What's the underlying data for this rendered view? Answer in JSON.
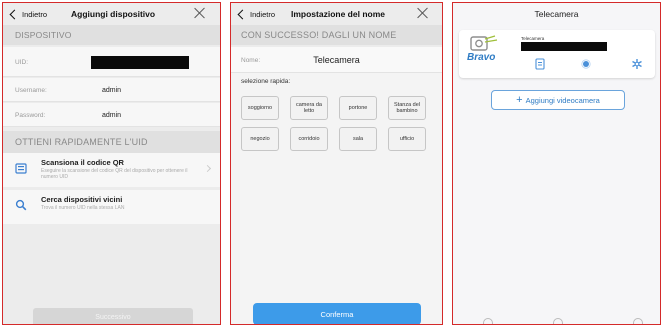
{
  "screen1": {
    "back_label": "Indietro",
    "title": "Aggiungi dispositivo",
    "section_device": "DISPOSITIVO",
    "uid_label": "UID:",
    "username_label": "Username:",
    "username_value": "admin",
    "password_label": "Password:",
    "password_value": "admin",
    "section_uid": "OTTIENI RAPIDAMENTE L'UID",
    "qr_title": "Scansiona il codice QR",
    "qr_desc": "Eseguire la scansione del codice QR del dispositivo per ottenere il numero UID",
    "search_title": "Cerca dispositivi vicini",
    "search_desc": "Trova il numero UID nella stessa LAN",
    "next_button": "Successivo"
  },
  "screen2": {
    "back_label": "Indietro",
    "title": "Impostazione del nome",
    "success_banner": "CON SUCCESSO! DAGLI UN NOME",
    "name_label": "Nome:",
    "name_value": "Telecamera",
    "quick_label": "selezione rapida:",
    "chips": [
      "soggiorno",
      "camera da letto",
      "portone",
      "Stanza del bambino",
      "negozio",
      "corridoio",
      "sala",
      "ufficio"
    ],
    "confirm_button": "Conferma"
  },
  "screen3": {
    "title": "Telecamera",
    "camera_name": "Telecamera",
    "brand": "Bravo",
    "add_button": "Aggiungi videocamera"
  },
  "colors": {
    "accent_blue": "#3d9be9",
    "panel_border": "#d42a2a"
  }
}
